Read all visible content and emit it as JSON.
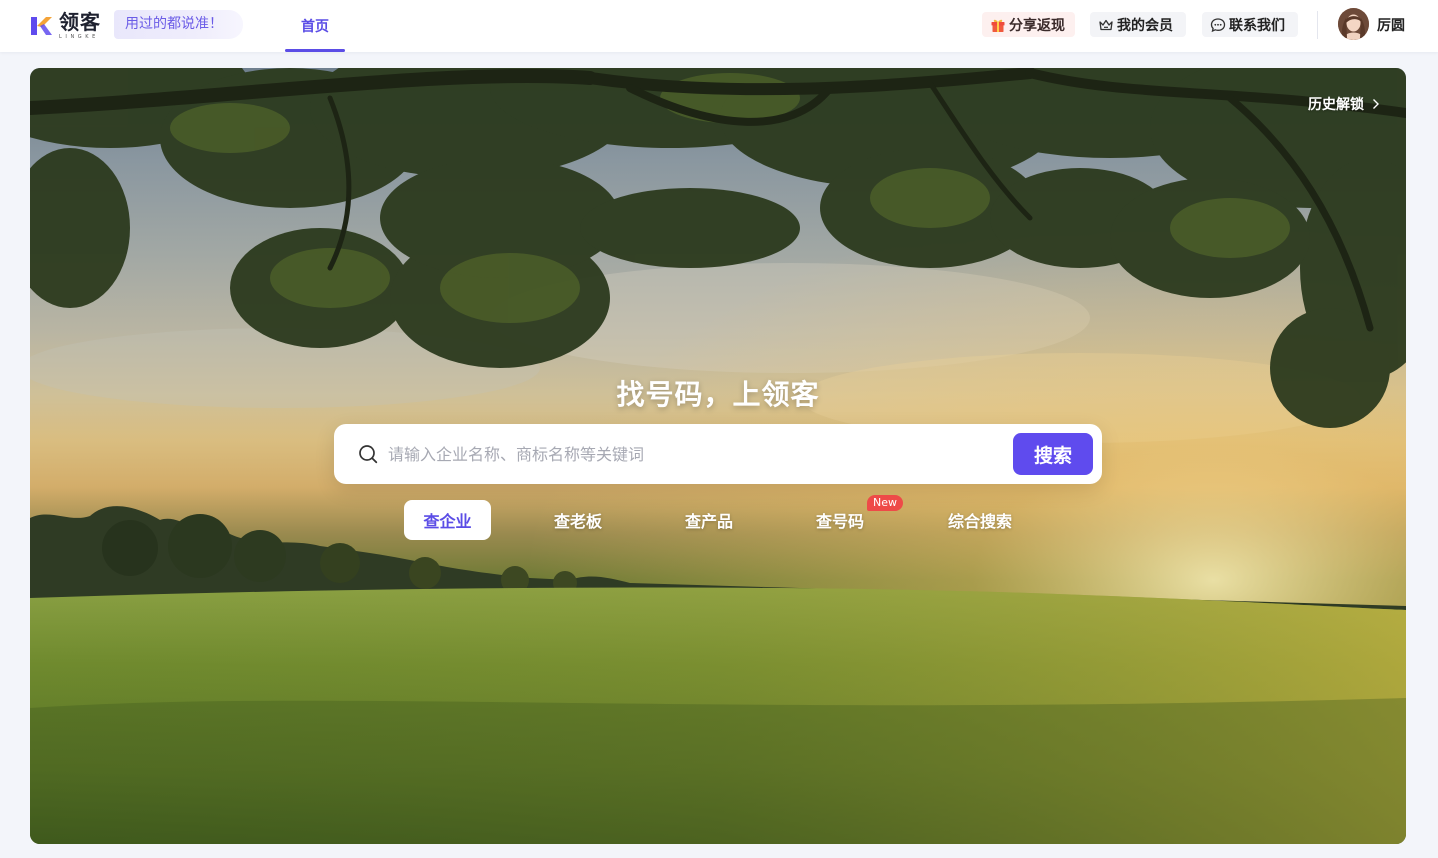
{
  "header": {
    "logo_cn": "领客",
    "logo_en": "LINGKE",
    "slogan": "用过的都说准！",
    "nav_home": "首页",
    "share_label": "分享返现",
    "member_label": "我的会员",
    "contact_label": "联系我们",
    "username": "厉圆"
  },
  "hero": {
    "history_label": "历史解锁",
    "title": "找号码，上领客",
    "search_placeholder": "请输入企业名称、商标名称等关键词",
    "search_button": "搜索",
    "tabs": [
      {
        "label": "查企业",
        "active": true
      },
      {
        "label": "查老板",
        "active": false
      },
      {
        "label": "查产品",
        "active": false
      },
      {
        "label": "查号码",
        "active": false,
        "badge": "New"
      },
      {
        "label": "综合搜索",
        "active": false
      }
    ]
  },
  "colors": {
    "brand": "#5f4bee",
    "badge": "#ee4a48"
  }
}
